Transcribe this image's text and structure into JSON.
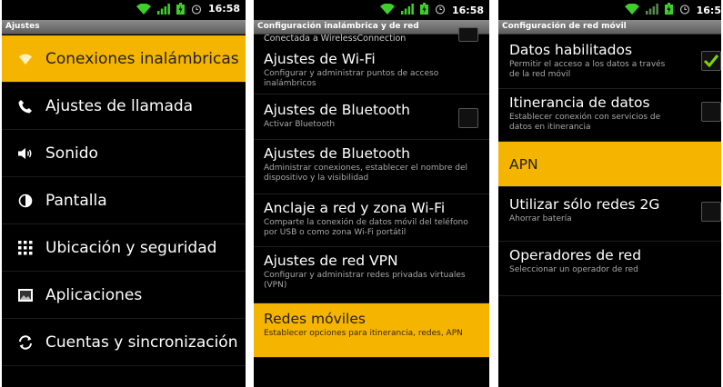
{
  "status": {
    "time": "16:58",
    "time2": "16:58",
    "time3": "16:5"
  },
  "screen1": {
    "title": "Ajustes",
    "items": [
      {
        "label": "Conexiones inalámbricas",
        "icon": "wifi-icon"
      },
      {
        "label": "Ajustes de llamada",
        "icon": "phone-handset-icon"
      },
      {
        "label": "Sonido",
        "icon": "speaker-icon"
      },
      {
        "label": "Pantalla",
        "icon": "brightness-icon"
      },
      {
        "label": "Ubicación y seguridad",
        "icon": "location-grid-icon"
      },
      {
        "label": "Aplicaciones",
        "icon": "applications-icon"
      },
      {
        "label": "Cuentas y sincronización",
        "icon": "sync-icon"
      }
    ]
  },
  "screen2": {
    "title": "Configuración inalámbrica y de red",
    "partial": "Conectada a WirelessConnection",
    "items": [
      {
        "title": "Ajustes de Wi-Fi",
        "sub": "Configurar y administrar puntos de acceso inalámbricos"
      },
      {
        "title": "Ajustes de Bluetooth",
        "sub": "Activar Bluetooth"
      },
      {
        "title": "Ajustes de Bluetooth",
        "sub": "Administrar conexiones, establecer el nombre del dispositivo y la visibilidad"
      },
      {
        "title": "Anclaje a red y zona Wi-Fi",
        "sub": "Comparte la conexión de datos móvil del teléfono por USB o como zona Wi-Fi portátil"
      },
      {
        "title": "Ajustes de red VPN",
        "sub": "Configurar y administrar redes privadas virtuales (VPN)"
      },
      {
        "title": "Redes móviles",
        "sub": "Establecer opciones para itinerancia, redes, APN"
      }
    ]
  },
  "screen3": {
    "title": "Configuración de red móvil",
    "items": [
      {
        "title": "Datos habilitados",
        "sub": "Permitir el acceso a los datos a través de la red móvil"
      },
      {
        "title": "Itinerancia de datos",
        "sub": "Establecer conexión con servicios de datos en itinerancia"
      },
      {
        "title": "APN",
        "sub": ""
      },
      {
        "title": "Utilizar sólo redes 2G",
        "sub": "Ahorrar batería"
      },
      {
        "title": "Operadores de red",
        "sub": "Seleccionar un operador de red"
      }
    ]
  },
  "colors": {
    "highlight": "#f5b400",
    "check": "#7fd400",
    "statusGreen": "#3ecf2a"
  }
}
